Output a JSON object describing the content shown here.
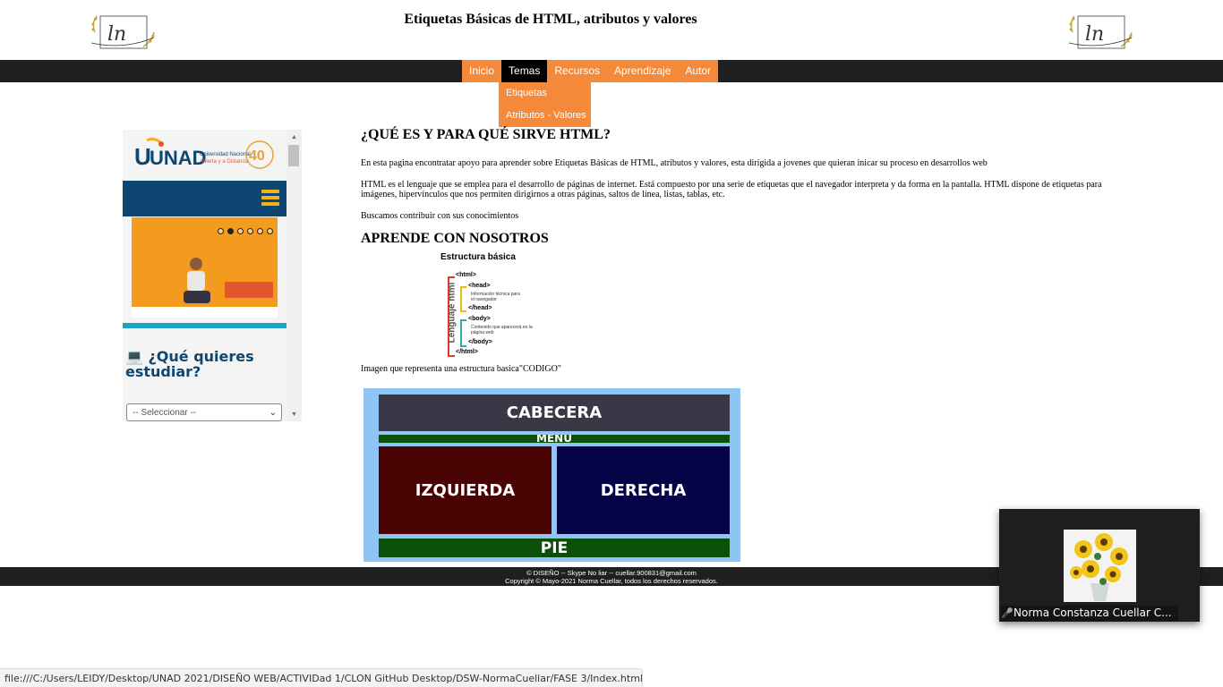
{
  "header": {
    "title": "Etiquetas Básicas de HTML, atributos y valores"
  },
  "nav": {
    "items": [
      {
        "label": "Inicio"
      },
      {
        "label": "Temas"
      },
      {
        "label": "Recursos"
      },
      {
        "label": "Aprendizaje"
      },
      {
        "label": "Autor"
      }
    ],
    "active": "Temas",
    "dropdown": [
      {
        "label": "Etiquetas"
      },
      {
        "label": "Atributos - Valores"
      }
    ]
  },
  "sidebar": {
    "logo_text": "UNAD",
    "logo_subtitle_1": "Universidad Nacional",
    "logo_subtitle_2": "Abierta y a Distancia",
    "anniversary": "40",
    "question": "¿Qué quieres estudiar?",
    "select_value": "-- Seleccionar --"
  },
  "main": {
    "heading1": "¿QUÉ ES Y PARA QUÉ SIRVE HTML?",
    "para1": "En esta pagina encontratar apoyo para aprender sobre Etiquetas Básicas de HTML, atributos y valores, esta dirigida a jovenes que quieran inicar su proceso en desarrollos web",
    "para2": "HTML es el lenguaje que se emplea para el desarrollo de páginas de internet. Está compuesto por una serie de etiquetas que el navegador interpreta y da forma en la pantalla. HTML dispone de etiquetas para imágenes, hipervínculos que nos permiten dirigirnos a otras páginas, saltos de línea, listas, tablas, etc.",
    "para3": "Buscamos contribuir con sus conocimientos",
    "heading2": "APRENDE CON NOSOTROS",
    "structure": {
      "title": "Estructura básica",
      "side_label": "Lenguaje html",
      "html_open": "<html>",
      "head_open": "<head>",
      "head_desc": "Información técnica para el navegador",
      "head_close": "</head>",
      "body_open": "<body>",
      "body_desc": "Contenido que aparecerá en la página web",
      "body_close": "</body>",
      "html_close": "</html>"
    },
    "caption1": "Imagen que representa una estructura basica\"CODIGO\"",
    "layout": {
      "cabecera": "CABECERA",
      "menu": "MENÚ",
      "izquierda": "IZQUIERDA",
      "derecha": "DERECHA",
      "pie": "PIE"
    }
  },
  "footer": {
    "line1": "© DISEÑO -- Skype No liar -- cuellar.900831@gmail.com",
    "line2": "Copyright © Mayo-2021 Norma Cuellar, todos los derechos reservados."
  },
  "video_tile": {
    "participant_name": "Norma Constanza Cuellar C..."
  },
  "status_bar": {
    "url": "file:///C:/Users/LEIDY/Desktop/UNAD 2021/DISEÑO WEB/ACTIVIDad 1/CLON GitHub Desktop/DSW-NormaCuellar/FASE 3/Index.html"
  },
  "colors": {
    "nav_orange": "#f5893a",
    "navbar_dark": "#1f1f1f",
    "unad_blue": "#0d4670"
  }
}
